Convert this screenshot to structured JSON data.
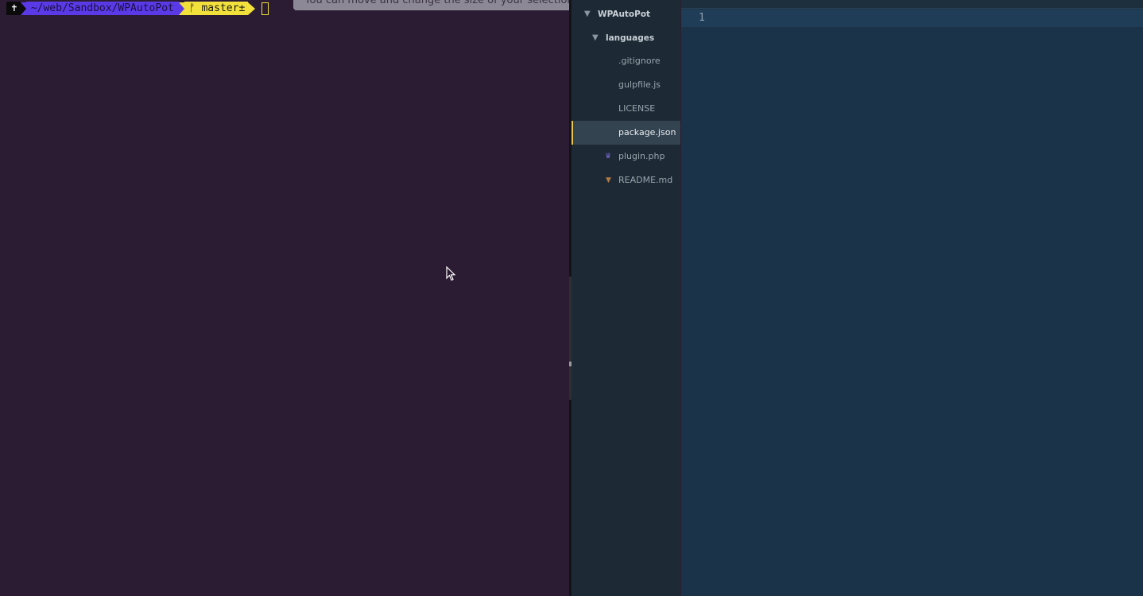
{
  "terminal": {
    "prompt": {
      "user_symbol": "✝",
      "path": "~/web/Sandbox/WPAutoPot",
      "git_branch_icon": "ᚠ",
      "git_branch": "master±"
    },
    "tooltip": "You can move and change the size of your selection"
  },
  "sidebar": {
    "root": "WPAutoPot",
    "items": [
      {
        "label": "languages",
        "kind": "folder"
      },
      {
        "label": ".gitignore",
        "kind": "file"
      },
      {
        "label": "gulpfile.js",
        "kind": "file"
      },
      {
        "label": "LICENSE",
        "kind": "file"
      },
      {
        "label": "package.json",
        "kind": "file",
        "selected": true
      },
      {
        "label": "plugin.php",
        "kind": "file",
        "icon": "php-icon"
      },
      {
        "label": "README.md",
        "kind": "file",
        "icon": "markdown-icon"
      }
    ]
  },
  "editor": {
    "line_numbers": [
      "1"
    ]
  },
  "colors": {
    "terminal_bg": "#2c1c33",
    "path_segment": "#5a3ae6",
    "git_segment": "#f2e13b",
    "sidebar_bg": "#1d2a35",
    "editor_bg": "#1b3349",
    "selection_accent": "#e7c547"
  }
}
